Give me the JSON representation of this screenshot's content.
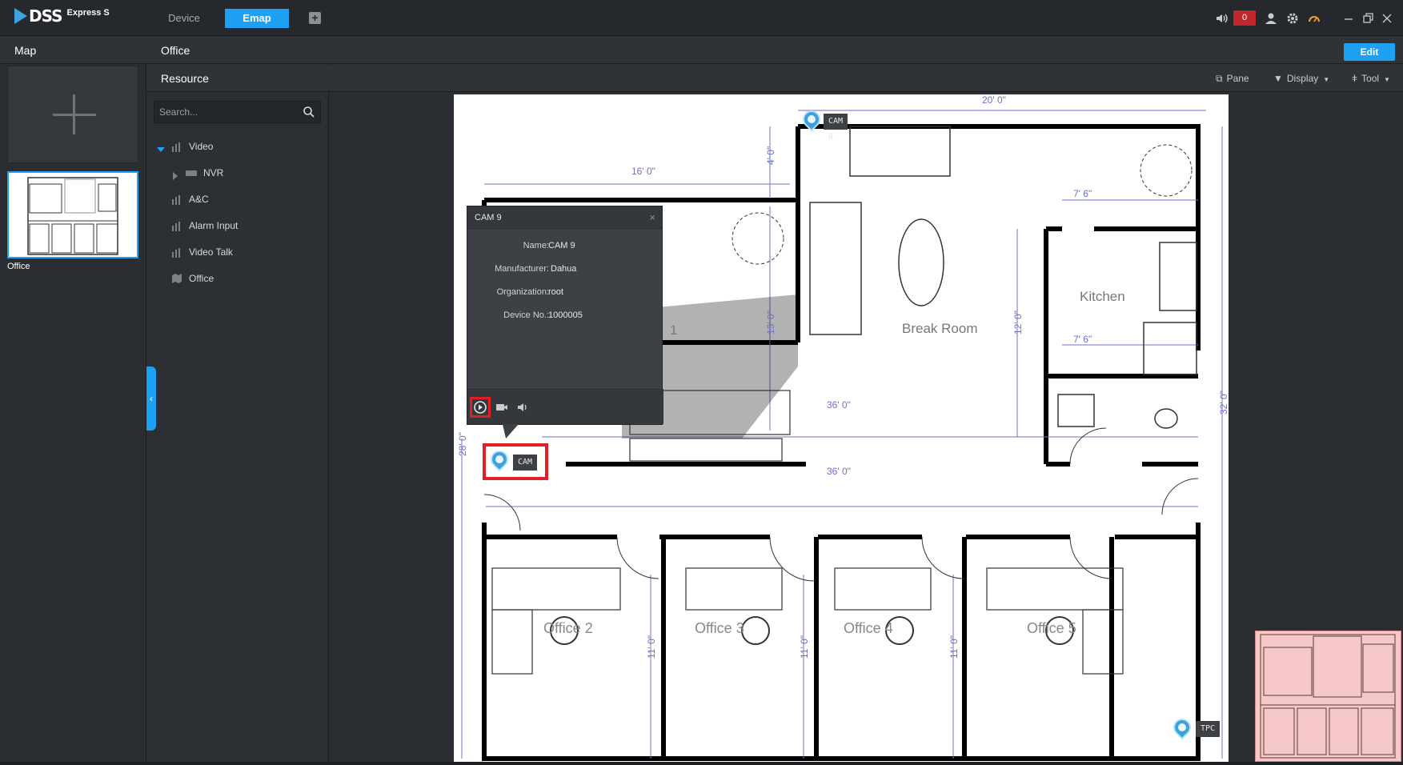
{
  "app": {
    "logo_text": "DSS",
    "logo_sub": "Express S"
  },
  "top_tabs": {
    "device": "Device",
    "emap": "Emap",
    "add": "+"
  },
  "top_right": {
    "alarm_count": "0"
  },
  "map_panel": {
    "title": "Map",
    "thumbnail_label": "Office"
  },
  "content_header": {
    "title": "Office",
    "edit_label": "Edit"
  },
  "resource_panel": {
    "title": "Resource",
    "search_placeholder": "Search...",
    "tree": [
      {
        "label": "Video",
        "expanded": true
      },
      {
        "label": "NVR"
      },
      {
        "label": "A&C"
      },
      {
        "label": "Alarm Input"
      },
      {
        "label": "Video Talk"
      },
      {
        "label": "Office"
      }
    ]
  },
  "toolbar": {
    "pane": "Pane",
    "display": "Display",
    "tool": "Tool"
  },
  "floorplan": {
    "rooms": {
      "break_room": "Break Room",
      "kitchen": "Kitchen",
      "office_1": "1",
      "office_2": "Office 2",
      "office_3": "Office 3",
      "office_4": "Office 4",
      "office_5": "Office 5"
    },
    "dimensions": {
      "d20": "20' 0\"",
      "d16": "16' 0\"",
      "d4": "4' 0\"",
      "d7_6a": "7' 6\"",
      "d7_6b": "7' 6\"",
      "d13": "13' 0\"",
      "d12": "12' 0\"",
      "d36a": "36' 0\"",
      "d36b": "36' 0\"",
      "d32": "32' 0\"",
      "d28": "28' 0\"",
      "d11a": "11' 0\"",
      "d11b": "11' 0\"",
      "d11c": "11' 0\""
    }
  },
  "cameras": {
    "cam8": "CAM 8",
    "cam9": "CAM 9",
    "tpc": "TPC"
  },
  "popup": {
    "title": "CAM 9",
    "close": "×",
    "fields": [
      {
        "key": "Name:",
        "value": "CAM 9"
      },
      {
        "key": "Manufacturer:",
        "value": "Dahua"
      },
      {
        "key": "Organization:",
        "value": "root"
      },
      {
        "key": "Device No.:",
        "value": "1000005"
      }
    ]
  },
  "colors": {
    "accent": "#1ea1f2",
    "highlight": "#e11d25",
    "dimension": "#7070c8"
  },
  "icons": [
    "speaker-icon",
    "user-icon",
    "gear-icon",
    "performance-icon",
    "minimize-icon",
    "restore-icon",
    "close-icon",
    "search-icon",
    "play-icon",
    "record-icon",
    "audio-icon",
    "pane-icon",
    "filter-icon",
    "tool-icon"
  ]
}
